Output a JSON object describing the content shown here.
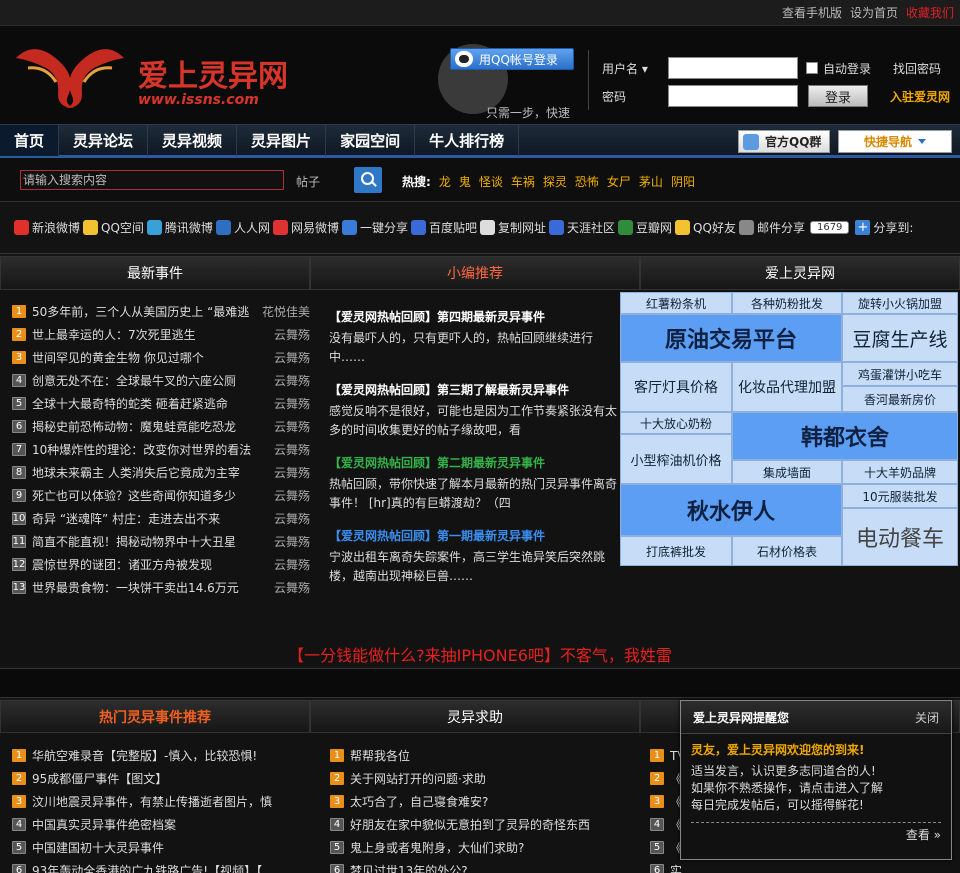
{
  "topbar": {
    "mobile": "查看手机版",
    "home": "设为首页",
    "fav": "收藏我们"
  },
  "header": {
    "logo_text": "爱上灵异网",
    "logo_url": "www.issns.com",
    "qq_login": "用QQ帐号登录",
    "qq_tip": "只需一步，快速开始",
    "login": {
      "username_label": "用户名",
      "password_label": "密码",
      "auto": "自动登录",
      "find": "找回密码",
      "button": "登录",
      "join": "入驻爱灵网"
    }
  },
  "nav": {
    "items": [
      "首页",
      "灵异论坛",
      "灵异视频",
      "灵异图片",
      "家园空间",
      "牛人排行榜"
    ],
    "qqgroup": "官方QQ群",
    "quicknav": "快捷导航"
  },
  "search": {
    "placeholder": "请输入搜索内容",
    "type": "帖子",
    "hot_label": "热搜:",
    "hot": [
      "龙",
      "鬼",
      "怪谈",
      "车祸",
      "探灵",
      "恐怖",
      "女尸",
      "茅山",
      "阴阳"
    ]
  },
  "share": {
    "items": [
      "新浪微博",
      "QQ空间",
      "腾讯微博",
      "人人网",
      "网易微博",
      "一键分享",
      "百度贴吧",
      "复制网址",
      "天涯社区",
      "豆瓣网",
      "QQ好友",
      "邮件分享"
    ],
    "count": "1679",
    "label": "分享到:"
  },
  "col1": {
    "title": "最新事件",
    "rows": [
      {
        "n": "1",
        "t": "50多年前，三个人从美国历史上 “最难逃",
        "a": "花悦佳美"
      },
      {
        "n": "2",
        "t": "世上最幸运的人：7次死里逃生",
        "a": "云舞殇"
      },
      {
        "n": "3",
        "t": "世间罕见的黄金生物 你见过哪个",
        "a": "云舞殇"
      },
      {
        "n": "4",
        "t": "创意无处不在：全球最牛叉的六座公厕",
        "a": "云舞殇"
      },
      {
        "n": "5",
        "t": "全球十大最奇特的蛇类 砸着赶紧逃命",
        "a": "云舞殇"
      },
      {
        "n": "6",
        "t": "揭秘史前恐怖动物：魔鬼蛙竟能吃恐龙",
        "a": "云舞殇"
      },
      {
        "n": "7",
        "t": "10种爆炸性的理论：改变你对世界的看法",
        "a": "云舞殇"
      },
      {
        "n": "8",
        "t": "地球未来霸主 人类消失后它竟成为主宰",
        "a": "云舞殇"
      },
      {
        "n": "9",
        "t": "死亡也可以体验？这些奇闻你知道多少",
        "a": "云舞殇"
      },
      {
        "n": "10",
        "t": "奇异 “迷魂阵” 村庄：走进去出不来",
        "a": "云舞殇"
      },
      {
        "n": "11",
        "t": "简直不能直视！揭秘动物界中十大丑星",
        "a": "云舞殇"
      },
      {
        "n": "12",
        "t": "震惊世界的谜团：诸亚方舟被发现",
        "a": "云舞殇"
      },
      {
        "n": "13",
        "t": "世界最贵食物：一块饼干卖出14.6万元",
        "a": "云舞殇"
      }
    ]
  },
  "col2": {
    "title": "小编推荐",
    "items": [
      {
        "t": "【爱灵网热帖回顾】第四期最新灵异事件",
        "d": "没有最吓人的，只有更吓人的，热帖回顾继续进行中……"
      },
      {
        "t": "【爱灵网热帖回顾】第三期了解最新灵异事件",
        "d": "感觉反响不是很好，可能也是因为工作节奏紧张没有太多的时间收集更好的帖子缘故吧，看"
      },
      {
        "t": "【爱灵网热帖回顾】第二期最新灵异事件",
        "d": "热帖回顾，带你快速了解本月最新的热门灵异事件离奇事件！ [hr]真的有巨蟒渡劫？（四"
      },
      {
        "t": "【爱灵网热帖回顾】第一期最新灵异事件",
        "d": "宁波出租车离奇失踪案件，高三学生诡异笑后突然跳楼，越南出现神秘巨兽……"
      }
    ]
  },
  "col3": {
    "title": "爱上灵异网",
    "ads": [
      "红薯粉条机",
      "各种奶粉批发",
      "旋转小火锅加盟",
      "原油交易平台",
      "豆腐生产线",
      "客厅灯具价格",
      "化妆品代理加盟",
      "鸡蛋灌饼小吃车",
      "香河最新房价",
      "十大放心奶粉",
      "韩都衣舍",
      "小型榨油机价格",
      "集成墙面",
      "十大羊奶品牌",
      "秋水伊人",
      "10元服装批发",
      "打底裤批发",
      "石材价格表",
      "电动餐车"
    ]
  },
  "promo": "【一分钱能做什么?来抽IPHONE6吧】不客气，我姓雷",
  "sec2": {
    "h1": "热门灵异事件推荐",
    "h2": "灵异求助",
    "l1": [
      {
        "n": "1",
        "t": "华航空难录音【完整版】-慎入，比较恐惧!"
      },
      {
        "n": "2",
        "t": "95成都僵尸事件【图文】"
      },
      {
        "n": "3",
        "t": "汶川地震灵异事件，有禁止传播逝者图片，慎"
      },
      {
        "n": "4",
        "t": "中国真实灵异事件绝密档案"
      },
      {
        "n": "5",
        "t": "中国建国初十大灵异事件"
      },
      {
        "n": "6",
        "t": "93年轰动全香港的广九铁路广告!【视频】【"
      }
    ],
    "l2": [
      {
        "n": "1",
        "t": "帮帮我各位"
      },
      {
        "n": "2",
        "t": "关于网站打开的问题·求助"
      },
      {
        "n": "3",
        "t": "太巧合了，自己寝食难安?"
      },
      {
        "n": "4",
        "t": "好朋友在家中貌似无意拍到了灵异的奇怪东西"
      },
      {
        "n": "5",
        "t": "鬼上身或者鬼附身，大仙们求助?"
      },
      {
        "n": "6",
        "t": "梦见过世13年的外公?"
      }
    ],
    "l3": [
      {
        "n": "1",
        "t": "TV"
      },
      {
        "n": "2",
        "t": "《"
      },
      {
        "n": "3",
        "t": "《"
      },
      {
        "n": "4",
        "t": "《"
      },
      {
        "n": "5",
        "t": "《"
      },
      {
        "n": "6",
        "t": "实"
      }
    ]
  },
  "popup": {
    "title": "爱上灵异网提醒您",
    "close": "关闭",
    "welcome": "灵友，爱上灵异网欢迎您的到来!",
    "line1": "适当发言，认识更多志同道合的人!",
    "line2": "如果你不熟悉操作，请点击进入了解",
    "line3": "每日完成发帖后，可以摇得鲜花!",
    "more": "查看 »"
  }
}
